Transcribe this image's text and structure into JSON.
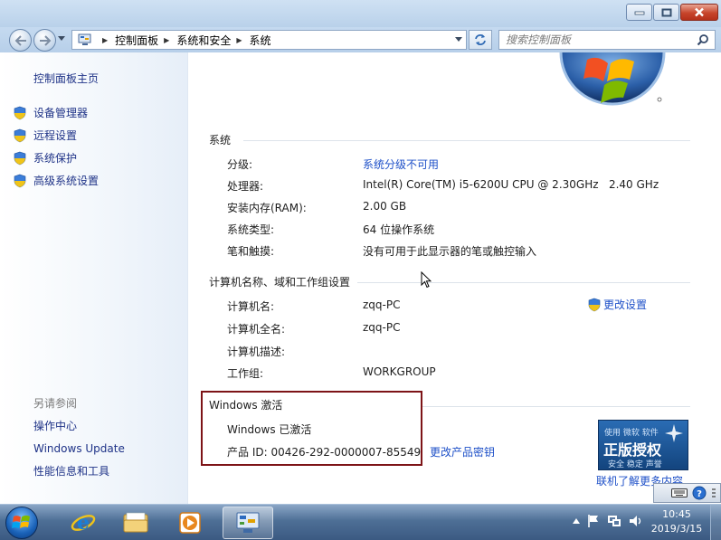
{
  "address": {
    "crumbs": [
      "控制面板",
      "系统和安全",
      "系统"
    ]
  },
  "search": {
    "placeholder": "搜索控制面板"
  },
  "left_pane": {
    "home": "控制面板主页",
    "items": [
      {
        "label": "设备管理器",
        "icon": "uac-shield-icon"
      },
      {
        "label": "远程设置",
        "icon": "uac-shield-icon"
      },
      {
        "label": "系统保护",
        "icon": "uac-shield-icon"
      },
      {
        "label": "高级系统设置",
        "icon": "uac-shield-icon"
      }
    ],
    "see_also_title": "另请参阅",
    "see_also": [
      "操作中心",
      "Windows Update",
      "性能信息和工具"
    ]
  },
  "system": {
    "title": "系统",
    "rows": [
      {
        "key": "分级:",
        "value": "系统分级不可用"
      },
      {
        "key": "处理器:",
        "value": "Intel(R) Core(TM) i5-6200U CPU @ 2.30GHz   2.40 GHz"
      },
      {
        "key": "安装内存(RAM):",
        "value": "2.00 GB"
      },
      {
        "key": "系统类型:",
        "value": "64 位操作系统"
      },
      {
        "key": "笔和触摸:",
        "value": "没有可用于此显示器的笔或触控输入"
      }
    ]
  },
  "computer": {
    "title": "计算机名称、域和工作组设置",
    "change_settings": "更改设置",
    "rows": [
      {
        "key": "计算机名:",
        "value": "zqq-PC"
      },
      {
        "key": "计算机全名:",
        "value": "zqq-PC"
      },
      {
        "key": "计算机描述:",
        "value": ""
      },
      {
        "key": "工作组:",
        "value": "WORKGROUP"
      }
    ]
  },
  "activation": {
    "title": "Windows 激活",
    "status": "Windows 已激活",
    "product_id": "产品 ID: 00426-292-0000007-85549",
    "change_key": "更改产品密钥",
    "genuine_top": "使用 微软 软件",
    "genuine_main": "正版授权",
    "genuine_sub": "安全 稳定 声誉",
    "more_online": "联机了解更多内容..."
  },
  "taskbar": {
    "time": "10:45",
    "date": "2019/3/15"
  },
  "colors": {
    "link": "#1e50c8",
    "nav_link": "#1e3287",
    "highlight_box": "#7d1417"
  }
}
